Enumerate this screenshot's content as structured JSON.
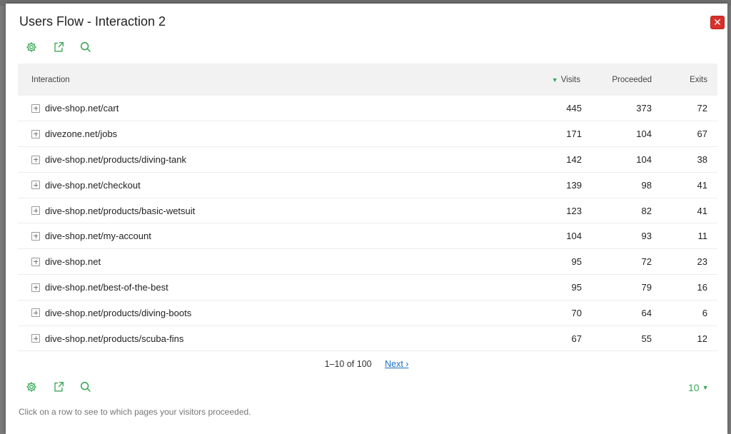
{
  "dialog": {
    "title": "Users Flow - Interaction 2",
    "close_label": "✕"
  },
  "colors": {
    "accent": "#3aa757",
    "close": "#d9302a",
    "link": "#1a6fc4"
  },
  "toolbar_icons": [
    "gear-icon",
    "export-icon",
    "search-icon"
  ],
  "table": {
    "headers": {
      "interaction": "Interaction",
      "visits": "Visits",
      "proceeded": "Proceeded",
      "exits": "Exits"
    },
    "sort_indicator": "▼",
    "rows": [
      {
        "label": "dive-shop.net/cart",
        "visits": "445",
        "proceeded": "373",
        "exits": "72"
      },
      {
        "label": "divezone.net/jobs",
        "visits": "171",
        "proceeded": "104",
        "exits": "67"
      },
      {
        "label": "dive-shop.net/products/diving-tank",
        "visits": "142",
        "proceeded": "104",
        "exits": "38"
      },
      {
        "label": "dive-shop.net/checkout",
        "visits": "139",
        "proceeded": "98",
        "exits": "41"
      },
      {
        "label": "dive-shop.net/products/basic-wetsuit",
        "visits": "123",
        "proceeded": "82",
        "exits": "41"
      },
      {
        "label": "dive-shop.net/my-account",
        "visits": "104",
        "proceeded": "93",
        "exits": "11"
      },
      {
        "label": "dive-shop.net",
        "visits": "95",
        "proceeded": "72",
        "exits": "23"
      },
      {
        "label": "dive-shop.net/best-of-the-best",
        "visits": "95",
        "proceeded": "79",
        "exits": "16"
      },
      {
        "label": "dive-shop.net/products/diving-boots",
        "visits": "70",
        "proceeded": "64",
        "exits": "6"
      },
      {
        "label": "dive-shop.net/products/scuba-fins",
        "visits": "67",
        "proceeded": "55",
        "exits": "12"
      }
    ]
  },
  "pagination": {
    "range": "1–10 of 100",
    "next_label": "Next ›"
  },
  "limit": {
    "value": "10",
    "caret": "▼"
  },
  "footer_note": "Click on a row to see to which pages your visitors proceeded."
}
